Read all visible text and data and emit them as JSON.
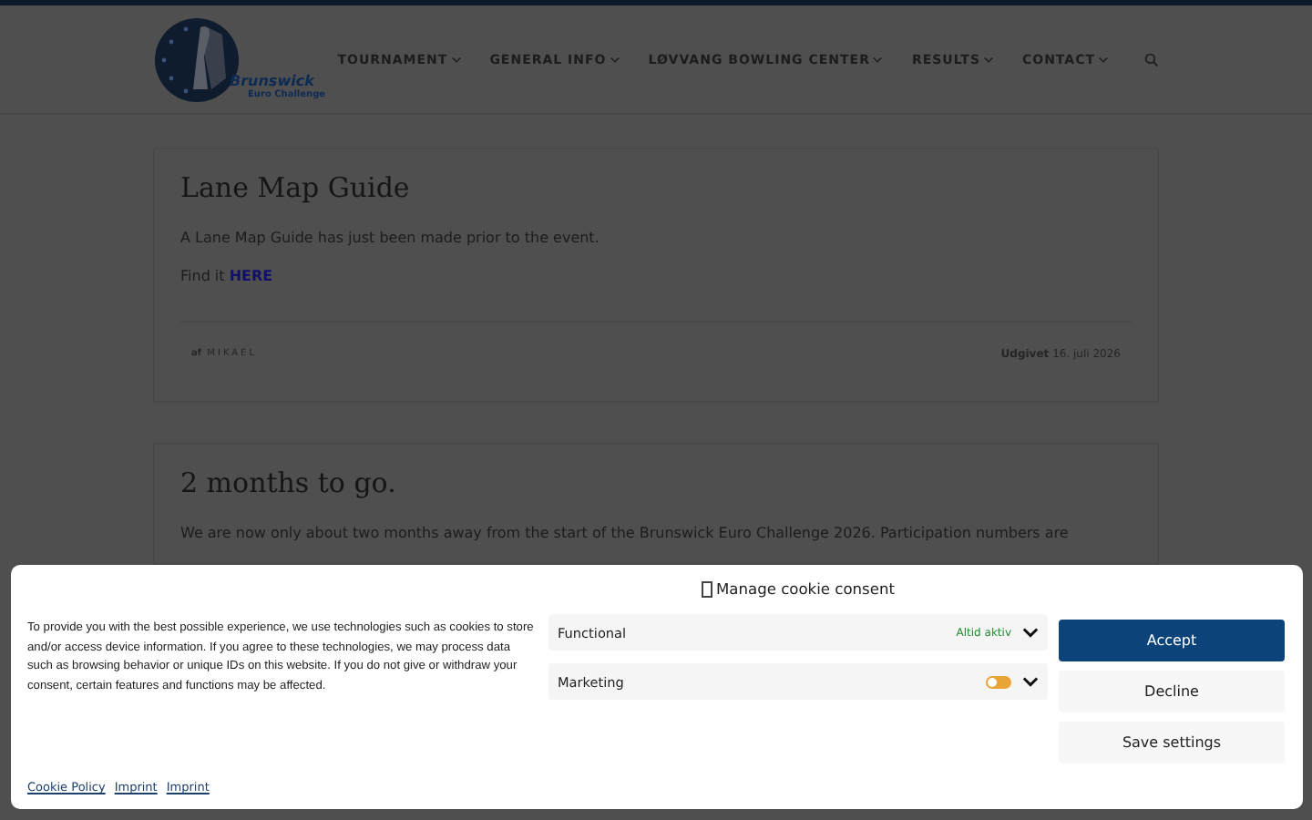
{
  "header": {
    "logo": {
      "name": "Brunswick",
      "tagline": "Euro Challenge"
    },
    "nav": [
      {
        "label": "TOURNAMENT",
        "has_menu": true
      },
      {
        "label": "GENERAL INFO",
        "has_menu": true
      },
      {
        "label": "LØVVANG BOWLING CENTER",
        "has_menu": true
      },
      {
        "label": "RESULTS",
        "has_menu": true
      },
      {
        "label": "CONTACT",
        "has_menu": true
      }
    ]
  },
  "posts": [
    {
      "title": "Lane Map Guide",
      "paragraphs": [
        "A Lane Map Guide has just been made prior to the event."
      ],
      "link_line": {
        "text": "Find it",
        "link": "HERE"
      },
      "author_prefix": "af",
      "author": "MIKAEL",
      "published_label": "Udgivet",
      "date": "16. juli 2026"
    },
    {
      "title": "2 months to go.",
      "paragraphs": [
        "We are now only about two months away from the start of the Brunswick Euro Challenge 2026. Participation numbers are"
      ]
    }
  ],
  "cookie_banner": {
    "title": "Manage cookie consent",
    "message": "To provide you with the best possible experience, we use technologies such as cookies to store and/or access device information. If you agree to these technologies, we may process data such as browsing behavior or unique IDs on this website. If you do not give or withdraw your consent, certain features and functions may be affected.",
    "categories": [
      {
        "kind": "always",
        "label": "Functional",
        "status": "Altid aktiv"
      },
      {
        "kind": "toggle",
        "label": "Marketing",
        "on": false
      }
    ],
    "buttons": [
      {
        "label": "Accept",
        "primary": true
      },
      {
        "label": "Decline",
        "primary": false
      },
      {
        "label": "Save settings",
        "primary": false
      }
    ],
    "links": [
      "Cookie Policy",
      "Imprint",
      "Imprint"
    ]
  }
}
